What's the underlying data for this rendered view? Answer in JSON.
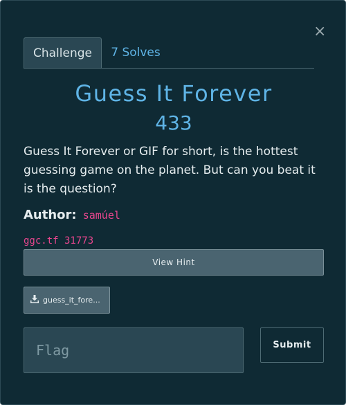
{
  "modal": {
    "close_symbol": "×"
  },
  "tabs": [
    {
      "label": "Challenge",
      "active": true
    },
    {
      "label": "7 Solves",
      "active": false
    }
  ],
  "challenge": {
    "title": "Guess It Forever",
    "points": "433",
    "description": "Guess It Forever or GIF for short, is the hottest guessing game on the planet. But can you beat it is the question?",
    "author_label": "Author:",
    "author_name": "samúel",
    "connection_info": "ggc.tf 31773"
  },
  "buttons": {
    "view_hint": "View Hint",
    "file_name": "guess_it_fore...",
    "file_icon": "download-icon",
    "submit": "Submit"
  },
  "flag_input": {
    "value": "",
    "placeholder": "Flag"
  },
  "colors": {
    "background": "#0f2a34",
    "accent": "#5fb4e6",
    "author": "#e8468e",
    "button": "#4a6470"
  }
}
